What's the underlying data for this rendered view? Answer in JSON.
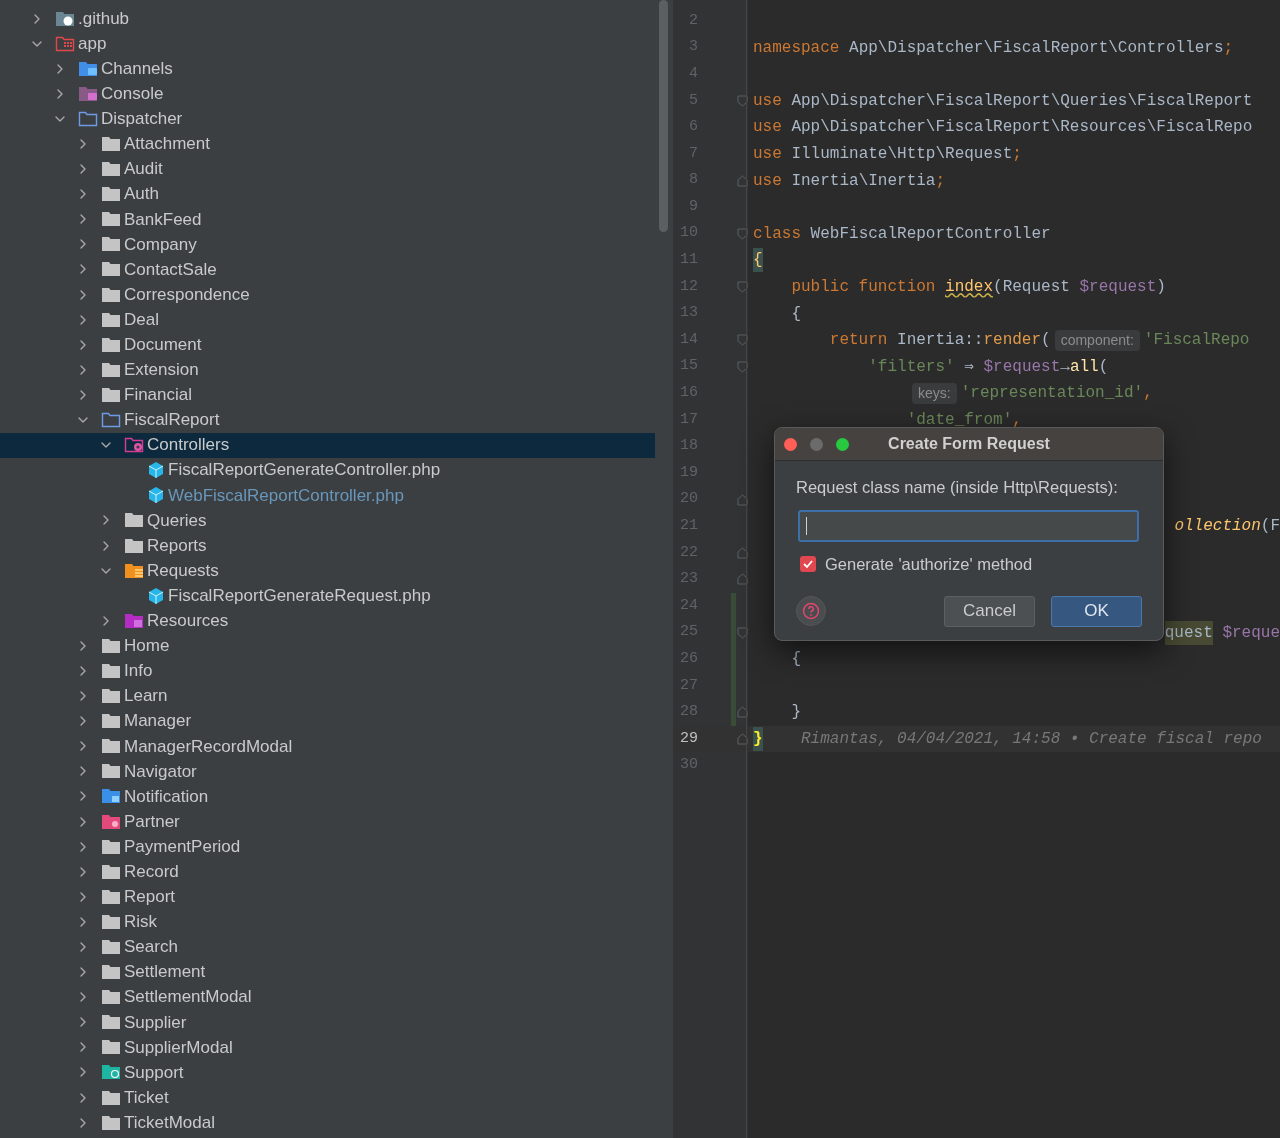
{
  "project_tree": {
    "items": [
      {
        "name": ".github",
        "kind": "github",
        "expanded": false,
        "selected": false
      },
      {
        "name": "app",
        "kind": "app",
        "expanded": true,
        "selected": false,
        "children": [
          {
            "name": "Channels",
            "kind": "channels",
            "expanded": false,
            "selected": false
          },
          {
            "name": "Console",
            "kind": "console",
            "expanded": false,
            "selected": false
          },
          {
            "name": "Dispatcher",
            "kind": "sources",
            "expanded": true,
            "selected": false,
            "children": [
              {
                "name": "Attachment",
                "kind": "folder",
                "expanded": false,
                "selected": false
              },
              {
                "name": "Audit",
                "kind": "folder",
                "expanded": false,
                "selected": false
              },
              {
                "name": "Auth",
                "kind": "folder",
                "expanded": false,
                "selected": false
              },
              {
                "name": "BankFeed",
                "kind": "folder",
                "expanded": false,
                "selected": false
              },
              {
                "name": "Company",
                "kind": "folder",
                "expanded": false,
                "selected": false
              },
              {
                "name": "ContactSale",
                "kind": "folder",
                "expanded": false,
                "selected": false
              },
              {
                "name": "Correspondence",
                "kind": "folder",
                "expanded": false,
                "selected": false
              },
              {
                "name": "Deal",
                "kind": "folder",
                "expanded": false,
                "selected": false
              },
              {
                "name": "Document",
                "kind": "folder",
                "expanded": false,
                "selected": false
              },
              {
                "name": "Extension",
                "kind": "folder",
                "expanded": false,
                "selected": false
              },
              {
                "name": "Financial",
                "kind": "folder",
                "expanded": false,
                "selected": false
              },
              {
                "name": "FiscalReport",
                "kind": "sources",
                "expanded": true,
                "selected": false,
                "children": [
                  {
                    "name": "Controllers",
                    "kind": "controllers",
                    "expanded": true,
                    "selected": true,
                    "children": [
                      {
                        "name": "FiscalReportGenerateController.php",
                        "kind": "file",
                        "modified": false,
                        "selected": false
                      },
                      {
                        "name": "WebFiscalReportController.php",
                        "kind": "file",
                        "modified": true,
                        "selected": false
                      }
                    ]
                  },
                  {
                    "name": "Queries",
                    "kind": "folder",
                    "expanded": false,
                    "selected": false
                  },
                  {
                    "name": "Reports",
                    "kind": "folder",
                    "expanded": false,
                    "selected": false
                  },
                  {
                    "name": "Requests",
                    "kind": "requests",
                    "expanded": true,
                    "selected": false,
                    "children": [
                      {
                        "name": "FiscalReportGenerateRequest.php",
                        "kind": "file",
                        "modified": false,
                        "selected": false
                      }
                    ]
                  },
                  {
                    "name": "Resources",
                    "kind": "resources",
                    "expanded": false,
                    "selected": false
                  }
                ]
              },
              {
                "name": "Home",
                "kind": "folder",
                "expanded": false,
                "selected": false
              },
              {
                "name": "Info",
                "kind": "folder",
                "expanded": false,
                "selected": false
              },
              {
                "name": "Learn",
                "kind": "folder",
                "expanded": false,
                "selected": false
              },
              {
                "name": "Manager",
                "kind": "folder",
                "expanded": false,
                "selected": false
              },
              {
                "name": "ManagerRecordModal",
                "kind": "folder",
                "expanded": false,
                "selected": false
              },
              {
                "name": "Navigator",
                "kind": "folder",
                "expanded": false,
                "selected": false
              },
              {
                "name": "Notification",
                "kind": "notifications",
                "expanded": false,
                "selected": false
              },
              {
                "name": "Partner",
                "kind": "partners",
                "expanded": false,
                "selected": false
              },
              {
                "name": "PaymentPeriod",
                "kind": "folder",
                "expanded": false,
                "selected": false
              },
              {
                "name": "Record",
                "kind": "folder",
                "expanded": false,
                "selected": false
              },
              {
                "name": "Report",
                "kind": "folder",
                "expanded": false,
                "selected": false
              },
              {
                "name": "Risk",
                "kind": "folder",
                "expanded": false,
                "selected": false
              },
              {
                "name": "Search",
                "kind": "folder",
                "expanded": false,
                "selected": false
              },
              {
                "name": "Settlement",
                "kind": "folder",
                "expanded": false,
                "selected": false
              },
              {
                "name": "SettlementModal",
                "kind": "folder",
                "expanded": false,
                "selected": false
              },
              {
                "name": "Supplier",
                "kind": "folder",
                "expanded": false,
                "selected": false
              },
              {
                "name": "SupplierModal",
                "kind": "folder",
                "expanded": false,
                "selected": false
              },
              {
                "name": "Support",
                "kind": "support",
                "expanded": false,
                "selected": false
              },
              {
                "name": "Ticket",
                "kind": "folder",
                "expanded": false,
                "selected": false
              },
              {
                "name": "TicketModal",
                "kind": "folder",
                "expanded": false,
                "selected": false
              }
            ]
          }
        ]
      }
    ]
  },
  "editor": {
    "lines": [
      {
        "number": "2",
        "kind": "code",
        "current": false,
        "changed": false
      },
      {
        "number": "3",
        "kind": "code",
        "current": false,
        "changed": false,
        "tokens": [
          {
            "kind": "kw",
            "text": "namespace"
          },
          {
            "kind": "plain",
            "text": " App\\Dispatcher\\FiscalReport\\Controllers"
          },
          {
            "kind": "kw",
            "text": ";"
          }
        ]
      },
      {
        "number": "4",
        "kind": "code",
        "current": false,
        "changed": false
      },
      {
        "number": "5",
        "kind": "code",
        "current": false,
        "changed": false,
        "fold": {
          "kind": "start"
        },
        "tokens": [
          {
            "kind": "kw",
            "text": "use"
          },
          {
            "kind": "plain",
            "text": " App\\Dispatcher\\FiscalReport\\Queries\\FiscalReport"
          }
        ]
      },
      {
        "number": "6",
        "kind": "code",
        "current": false,
        "changed": false,
        "tokens": [
          {
            "kind": "kw",
            "text": "use"
          },
          {
            "kind": "plain",
            "text": " App\\Dispatcher\\FiscalReport\\Resources\\FiscalRepo"
          }
        ]
      },
      {
        "number": "7",
        "kind": "code",
        "current": false,
        "changed": false,
        "tokens": [
          {
            "kind": "kw",
            "text": "use"
          },
          {
            "kind": "plain",
            "text": " Illuminate\\Http\\Request"
          },
          {
            "kind": "kw",
            "text": ";"
          }
        ]
      },
      {
        "number": "8",
        "kind": "code",
        "current": false,
        "changed": false,
        "fold": {
          "kind": "end"
        },
        "tokens": [
          {
            "kind": "kw",
            "text": "use"
          },
          {
            "kind": "plain",
            "text": " Inertia\\Inertia"
          },
          {
            "kind": "kw",
            "text": ";"
          }
        ]
      },
      {
        "number": "9",
        "kind": "code",
        "current": false,
        "changed": false
      },
      {
        "number": "10",
        "kind": "code",
        "current": false,
        "changed": false,
        "fold": {
          "kind": "start"
        },
        "tokens": [
          {
            "kind": "kw",
            "text": "class"
          },
          {
            "kind": "plain",
            "text": " WebFiscalReportController"
          }
        ]
      },
      {
        "number": "11",
        "kind": "code",
        "current": false,
        "changed": false,
        "tokens": [
          {
            "kind": "brace",
            "text": "{"
          }
        ]
      },
      {
        "number": "12",
        "kind": "code",
        "current": false,
        "changed": false,
        "fold": {
          "kind": "start"
        },
        "tokens": [
          {
            "kind": "kw",
            "text": "    public function "
          },
          {
            "kind": "decl",
            "text": "index"
          },
          {
            "kind": "plain",
            "text": "(Request "
          },
          {
            "kind": "var",
            "text": "$request"
          },
          {
            "kind": "plain",
            "text": ")"
          }
        ]
      },
      {
        "number": "13",
        "kind": "code",
        "current": false,
        "changed": false,
        "tokens": [
          {
            "kind": "plain",
            "text": "    {"
          }
        ]
      },
      {
        "number": "14",
        "kind": "code",
        "current": false,
        "changed": false,
        "fold": {
          "kind": "start"
        },
        "tokens": [
          {
            "kind": "kw",
            "text": "        return"
          },
          {
            "kind": "plain",
            "text": " Inertia::"
          },
          {
            "kind": "method",
            "text": "render"
          },
          {
            "kind": "plain",
            "text": "("
          },
          {
            "kind": "hint",
            "text": "component:"
          },
          {
            "kind": "str",
            "text": "'FiscalRepo"
          }
        ]
      },
      {
        "number": "15",
        "kind": "code",
        "current": false,
        "changed": false,
        "fold": {
          "kind": "start"
        },
        "tokens": [
          {
            "kind": "str",
            "text": "            'filters'"
          },
          {
            "kind": "plain",
            "text": " ⇒ "
          },
          {
            "kind": "var",
            "text": "$request"
          },
          {
            "kind": "plain",
            "text": "→"
          },
          {
            "kind": "call",
            "text": "all"
          },
          {
            "kind": "plain",
            "text": "("
          }
        ]
      },
      {
        "number": "16",
        "kind": "code",
        "current": false,
        "changed": false,
        "tokens": [
          {
            "kind": "hint",
            "text": "keys:"
          },
          {
            "kind": "str",
            "text": "'representation_id'"
          },
          {
            "kind": "kw",
            "text": ","
          }
        ]
      },
      {
        "number": "17",
        "kind": "code",
        "current": false,
        "changed": false,
        "tokens": [
          {
            "kind": "str",
            "text": "                'date_from'"
          },
          {
            "kind": "kw",
            "text": ","
          }
        ]
      },
      {
        "number": "18",
        "kind": "code",
        "current": false,
        "changed": false
      },
      {
        "number": "19",
        "kind": "code",
        "current": false,
        "changed": false
      },
      {
        "number": "20",
        "kind": "code",
        "current": false,
        "changed": false,
        "fold": {
          "kind": "end"
        }
      },
      {
        "number": "21",
        "kind": "fragment",
        "current": false,
        "changed": false,
        "tokens": [
          {
            "kind": "static",
            "text": "ollection"
          },
          {
            "kind": "plain",
            "text": "(F"
          }
        ]
      },
      {
        "number": "22",
        "kind": "code",
        "current": false,
        "changed": false,
        "fold": {
          "kind": "end"
        }
      },
      {
        "number": "23",
        "kind": "code",
        "current": false,
        "changed": false,
        "fold": {
          "kind": "end"
        }
      },
      {
        "number": "24",
        "kind": "code",
        "current": false,
        "changed": true
      },
      {
        "number": "25",
        "kind": "fragment",
        "current": false,
        "changed": true,
        "fold": {
          "kind": "start"
        },
        "tokens": [
          {
            "kind": "usage",
            "text": "quest"
          },
          {
            "kind": "var",
            "text": " $reque"
          }
        ]
      },
      {
        "number": "26",
        "kind": "code",
        "current": false,
        "changed": true,
        "tokens": [
          {
            "kind": "plain",
            "text": "    {"
          }
        ]
      },
      {
        "number": "27",
        "kind": "code",
        "current": false,
        "changed": true
      },
      {
        "number": "28",
        "kind": "code",
        "current": false,
        "changed": true,
        "fold": {
          "kind": "end"
        },
        "tokens": [
          {
            "kind": "plain",
            "text": "    }"
          }
        ]
      },
      {
        "number": "29",
        "kind": "code",
        "current": true,
        "changed": false,
        "fold": {
          "kind": "end"
        },
        "tokens": [
          {
            "kind": "brace_current",
            "text": "}"
          },
          {
            "kind": "blame",
            "text": "    Rimantas, 04/04/2021, 14:58 • Create fiscal repo"
          }
        ]
      },
      {
        "number": "30",
        "kind": "code",
        "current": false,
        "changed": false
      }
    ]
  },
  "dialog": {
    "title": "Create Form Request",
    "label": "Request class name (inside Http\\Requests):",
    "checkbox": {
      "label": "Generate 'authorize' method",
      "checked": true
    },
    "buttons": [
      {
        "label": "Cancel",
        "default": false
      },
      {
        "label": "OK",
        "default": true
      }
    ]
  }
}
